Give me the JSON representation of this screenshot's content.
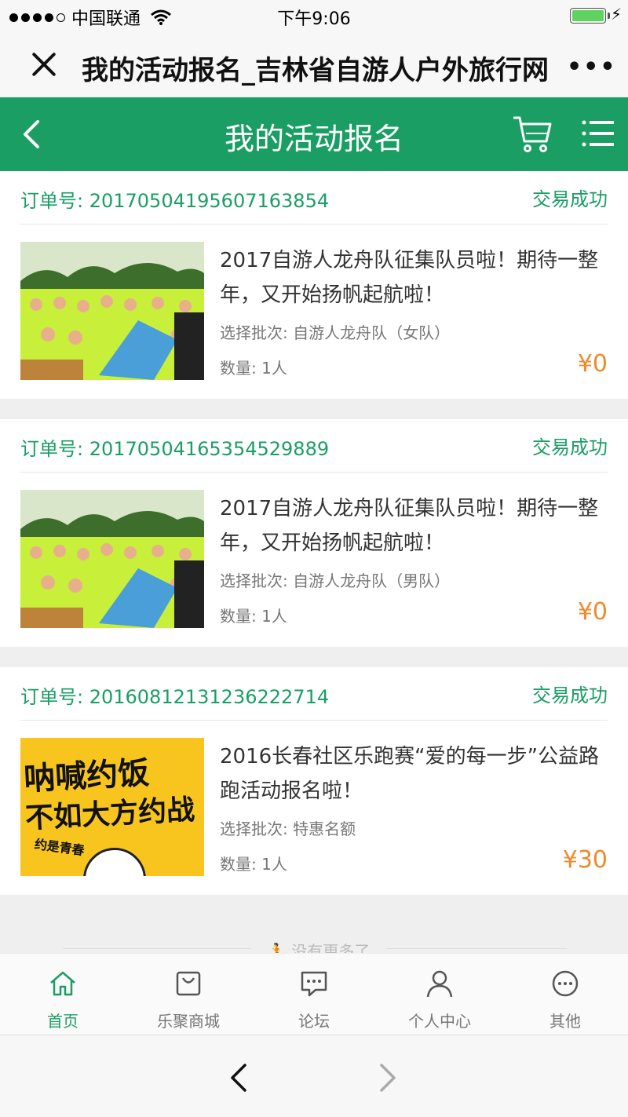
{
  "status_bar": {
    "carrier": "中国联通",
    "time": "下午9:06"
  },
  "browser": {
    "title": "我的活动报名_吉林省自游人户外旅行网"
  },
  "header": {
    "title": "我的活动报名"
  },
  "orders": [
    {
      "order_no": "订单号: 20170504195607163854",
      "status": "交易成功",
      "title": "2017自游人龙舟队征集队员啦！期待一整年，又开始扬帆起航啦！",
      "batch": "选择批次: 自游人龙舟队（女队）",
      "qty": "数量: 1人",
      "price": "¥0"
    },
    {
      "order_no": "订单号: 20170504165354529889",
      "status": "交易成功",
      "title": "2017自游人龙舟队征集队员啦！期待一整年，又开始扬帆起航啦！",
      "batch": "选择批次: 自游人龙舟队（男队）",
      "qty": "数量: 1人",
      "price": "¥0"
    },
    {
      "order_no": "订单号: 20160812131236222714",
      "status": "交易成功",
      "title": "2016长春社区乐跑赛“爱的每一步”公益路跑活动报名啦！",
      "batch": "选择批次: 特惠名额",
      "qty": "数量: 1人",
      "price": "¥30",
      "thumb_text": {
        "line1": "呐喊约饭",
        "line2": "不如大方约战",
        "line3": "约是青春"
      }
    }
  ],
  "end_marker": "没有更多了",
  "tabs": [
    {
      "label": "首页",
      "icon": "home-icon",
      "active": true
    },
    {
      "label": "乐聚商城",
      "icon": "shopping-bag-icon"
    },
    {
      "label": "论坛",
      "icon": "chat-icon"
    },
    {
      "label": "个人中心",
      "icon": "user-icon"
    },
    {
      "label": "其他",
      "icon": "more-circle-icon"
    }
  ],
  "colors": {
    "brand_green": "#1a9e64",
    "price_orange": "#ee8a2a",
    "poster_yellow": "#f7c51e"
  }
}
